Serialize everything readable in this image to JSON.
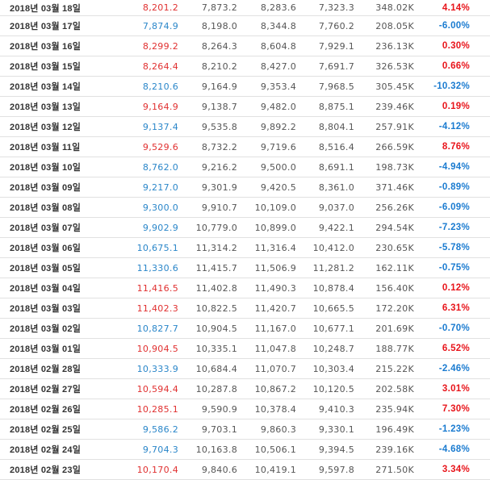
{
  "rows": [
    {
      "date": "2018년 03월 18일",
      "close": "8,201.2",
      "open": "7,873.2",
      "high": "8,283.6",
      "low": "7,323.3",
      "vol": "348.02K",
      "chg": "4.14%",
      "dir": "up"
    },
    {
      "date": "2018년 03월 17일",
      "close": "7,874.9",
      "open": "8,198.0",
      "high": "8,344.8",
      "low": "7,760.2",
      "vol": "208.05K",
      "chg": "-6.00%",
      "dir": "down"
    },
    {
      "date": "2018년 03월 16일",
      "close": "8,299.2",
      "open": "8,264.3",
      "high": "8,604.8",
      "low": "7,929.1",
      "vol": "236.13K",
      "chg": "0.30%",
      "dir": "up"
    },
    {
      "date": "2018년 03월 15일",
      "close": "8,264.4",
      "open": "8,210.2",
      "high": "8,427.0",
      "low": "7,691.7",
      "vol": "326.53K",
      "chg": "0.66%",
      "dir": "up"
    },
    {
      "date": "2018년 03월 14일",
      "close": "8,210.6",
      "open": "9,164.9",
      "high": "9,353.4",
      "low": "7,968.5",
      "vol": "305.45K",
      "chg": "-10.32%",
      "dir": "down"
    },
    {
      "date": "2018년 03월 13일",
      "close": "9,164.9",
      "open": "9,138.7",
      "high": "9,482.0",
      "low": "8,875.1",
      "vol": "239.46K",
      "chg": "0.19%",
      "dir": "up"
    },
    {
      "date": "2018년 03월 12일",
      "close": "9,137.4",
      "open": "9,535.8",
      "high": "9,892.2",
      "low": "8,804.1",
      "vol": "257.91K",
      "chg": "-4.12%",
      "dir": "down"
    },
    {
      "date": "2018년 03월 11일",
      "close": "9,529.6",
      "open": "8,732.2",
      "high": "9,719.6",
      "low": "8,516.4",
      "vol": "266.59K",
      "chg": "8.76%",
      "dir": "up"
    },
    {
      "date": "2018년 03월 10일",
      "close": "8,762.0",
      "open": "9,216.2",
      "high": "9,500.0",
      "low": "8,691.1",
      "vol": "198.73K",
      "chg": "-4.94%",
      "dir": "down"
    },
    {
      "date": "2018년 03월 09일",
      "close": "9,217.0",
      "open": "9,301.9",
      "high": "9,420.5",
      "low": "8,361.0",
      "vol": "371.46K",
      "chg": "-0.89%",
      "dir": "down"
    },
    {
      "date": "2018년 03월 08일",
      "close": "9,300.0",
      "open": "9,910.7",
      "high": "10,109.0",
      "low": "9,037.0",
      "vol": "256.26K",
      "chg": "-6.09%",
      "dir": "down"
    },
    {
      "date": "2018년 03월 07일",
      "close": "9,902.9",
      "open": "10,779.0",
      "high": "10,899.0",
      "low": "9,422.1",
      "vol": "294.54K",
      "chg": "-7.23%",
      "dir": "down"
    },
    {
      "date": "2018년 03월 06일",
      "close": "10,675.1",
      "open": "11,314.2",
      "high": "11,316.4",
      "low": "10,412.0",
      "vol": "230.65K",
      "chg": "-5.78%",
      "dir": "down"
    },
    {
      "date": "2018년 03월 05일",
      "close": "11,330.6",
      "open": "11,415.7",
      "high": "11,506.9",
      "low": "11,281.2",
      "vol": "162.11K",
      "chg": "-0.75%",
      "dir": "down"
    },
    {
      "date": "2018년 03월 04일",
      "close": "11,416.5",
      "open": "11,402.8",
      "high": "11,490.3",
      "low": "10,878.4",
      "vol": "156.40K",
      "chg": "0.12%",
      "dir": "up"
    },
    {
      "date": "2018년 03월 03일",
      "close": "11,402.3",
      "open": "10,822.5",
      "high": "11,420.7",
      "low": "10,665.5",
      "vol": "172.20K",
      "chg": "6.31%",
      "dir": "up"
    },
    {
      "date": "2018년 03월 02일",
      "close": "10,827.7",
      "open": "10,904.5",
      "high": "11,167.0",
      "low": "10,677.1",
      "vol": "201.69K",
      "chg": "-0.70%",
      "dir": "down"
    },
    {
      "date": "2018년 03월 01일",
      "close": "10,904.5",
      "open": "10,335.1",
      "high": "11,047.8",
      "low": "10,248.7",
      "vol": "188.77K",
      "chg": "6.52%",
      "dir": "up"
    },
    {
      "date": "2018년 02월 28일",
      "close": "10,333.9",
      "open": "10,684.4",
      "high": "11,070.7",
      "low": "10,303.4",
      "vol": "215.22K",
      "chg": "-2.46%",
      "dir": "down"
    },
    {
      "date": "2018년 02월 27일",
      "close": "10,594.4",
      "open": "10,287.8",
      "high": "10,867.2",
      "low": "10,120.5",
      "vol": "202.58K",
      "chg": "3.01%",
      "dir": "up"
    },
    {
      "date": "2018년 02월 26일",
      "close": "10,285.1",
      "open": "9,590.9",
      "high": "10,378.4",
      "low": "9,410.3",
      "vol": "235.94K",
      "chg": "7.30%",
      "dir": "up"
    },
    {
      "date": "2018년 02월 25일",
      "close": "9,586.2",
      "open": "9,703.1",
      "high": "9,860.3",
      "low": "9,330.1",
      "vol": "196.49K",
      "chg": "-1.23%",
      "dir": "down"
    },
    {
      "date": "2018년 02월 24일",
      "close": "9,704.3",
      "open": "10,163.8",
      "high": "10,506.1",
      "low": "9,394.5",
      "vol": "239.16K",
      "chg": "-4.68%",
      "dir": "down"
    },
    {
      "date": "2018년 02월 23일",
      "close": "10,170.4",
      "open": "9,840.6",
      "high": "10,419.1",
      "low": "9,597.8",
      "vol": "271.50K",
      "chg": "3.34%",
      "dir": "up"
    }
  ],
  "colors": {
    "up": "#e8141a",
    "down": "#1a7bd0",
    "close_up": "#e03030",
    "close_down": "#2a86c9"
  }
}
